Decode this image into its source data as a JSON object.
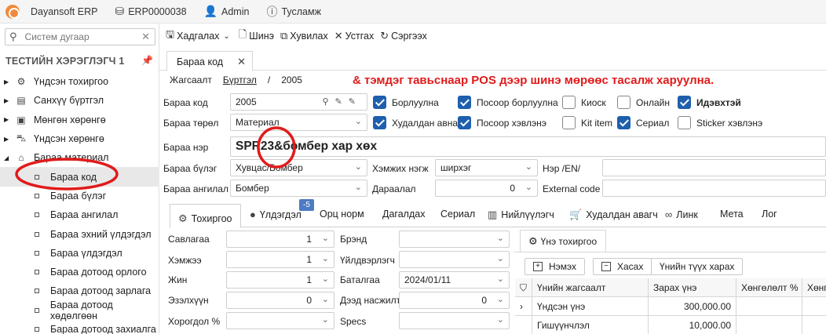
{
  "topbar": {
    "app_title": "Dayansoft ERP",
    "doc_number": "ERP0000038",
    "user": "Admin",
    "settings": "Тусламж"
  },
  "sidebar": {
    "search_placeholder": "Систем дугаар",
    "user_header": "ТЕСТИЙН ХЭРЭГЛЭГЧ 1",
    "items": [
      {
        "label": "Үндсэн тохиргоо",
        "icon": "gear-icon"
      },
      {
        "label": "Санхүү бүртгэл",
        "icon": "book-icon"
      },
      {
        "label": "Мөнгөн хөрөнгө",
        "icon": "money-icon"
      },
      {
        "label": "Үндсэн хөрөнгө",
        "icon": "car-icon"
      },
      {
        "label": "Бараа материал",
        "icon": "warehouse-icon"
      }
    ],
    "subitems": [
      "Бараа код",
      "Бараа бүлэг",
      "Бараа ангилал",
      "Бараа эхний үлдэгдэл",
      "Бараа үлдэгдэл",
      "Бараа дотоод орлого",
      "Бараа дотоод зарлага",
      "Бараа дотоод хөдөлгөөн",
      "Бараа дотоод захиалга"
    ]
  },
  "toolbar": {
    "save": "Хадгалах",
    "new": "Шинэ",
    "copy": "Хувилах",
    "delete": "Устгах",
    "refresh": "Сэргээх"
  },
  "doc_tab": "Бараа код",
  "breadcrumb": {
    "a": "Жагсаалт",
    "b": "Бүртгэл",
    "sep": "/",
    "c": "2005"
  },
  "banner": "& тэмдэг тавьснаар POS дээр шинэ мөрөөс тасалж харуулна.",
  "form": {
    "code_label": "Бараа код",
    "code_value": "2005",
    "type_label": "Бараа төрөл",
    "type_value": "Материал",
    "name_label": "Бараа нэр",
    "name_value": "SPR23&бомбер хар хөх",
    "group_label": "Бараа бүлэг",
    "group_value": "Хувцас/Бомбер",
    "unit_label": "Хэмжих нэгж",
    "unit_value": "ширхэг",
    "name_en_label": "Нэр /EN/",
    "class_label": "Бараа ангилал",
    "class_value": "Бомбер",
    "order_label": "Дараалал",
    "order_value": "0",
    "ext_label": "External code"
  },
  "checkboxes": [
    {
      "label": "Борлуулна",
      "checked": true
    },
    {
      "label": "Посоор борлуулна",
      "checked": true
    },
    {
      "label": "Киоск",
      "checked": false
    },
    {
      "label": "Онлайн",
      "checked": false
    },
    {
      "label": "Идэвхтэй",
      "checked": true
    },
    {
      "label": "Худалдан авна",
      "checked": true
    },
    {
      "label": "Посоор хэвлэнэ",
      "checked": true
    },
    {
      "label": "Kit item",
      "checked": false
    },
    {
      "label": "Сериал",
      "checked": true
    },
    {
      "label": "Sticker хэвлэнэ",
      "checked": false
    }
  ],
  "subtabs": {
    "settings": "Тохиргоо",
    "balance": "Үлдэгдэл",
    "badge": "-5",
    "norm": "Орц норм",
    "depend": "Дагалдах",
    "serial": "Сериал",
    "barcode": "Нийлүүлэгч",
    "supplier": "Худалдан авагч",
    "link": "Линк",
    "meta": "Мета",
    "log": "Лог"
  },
  "props": {
    "volume_label": "Савлагаа",
    "volume_value": "1",
    "measure_label": "Хэмжээ",
    "measure_value": "1",
    "weight_label": "Жин",
    "weight_value": "1",
    "capacity_label": "Эзэлхүүн",
    "capacity_value": "0",
    "discount_label": "Хорогдол %",
    "brand_label": "Брэнд",
    "maker_label": "Үйлдвэрлэгч",
    "warranty_label": "Баталгаа",
    "warranty_value": "2024/01/11",
    "min_label": "Дээд насжилт",
    "min_value": "0",
    "specs_label": "Specs"
  },
  "price": {
    "tab": "Үнэ тохиргоо",
    "add": "Нэмэх",
    "remove": "Хасах",
    "history": "Үнийн түүх харах",
    "col_name": "Үнийн жагсаалт",
    "col_price": "Зарах үнэ",
    "col_disc": "Хөнгөлөлт %",
    "col_more": "Хөнг",
    "rows": [
      {
        "name": "Үндсэн үнэ",
        "price": "300,000.00"
      },
      {
        "name": "Гишүүнчлэл",
        "price": "10,000.00"
      }
    ]
  },
  "colors": {
    "accent": "#1f5fad",
    "banner": "#e01b1b",
    "annotation": "#e01b1b"
  }
}
